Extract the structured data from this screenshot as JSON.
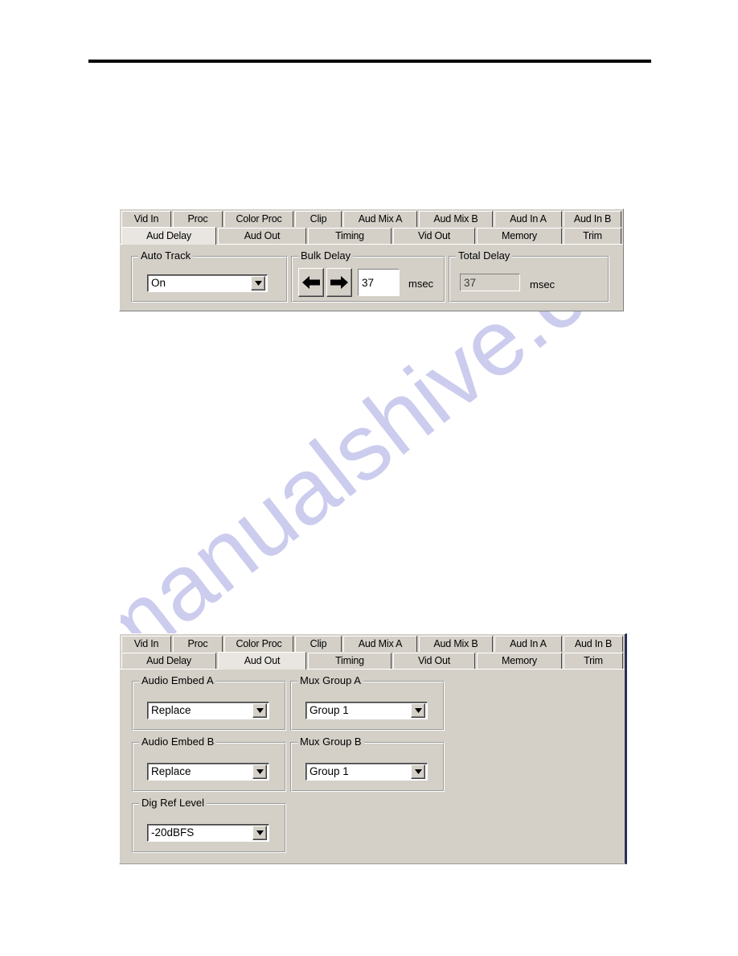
{
  "page": {
    "rule_visible": true,
    "watermark_text": "manualshive.com"
  },
  "colors": {
    "dialog_face": "#d4d0c8",
    "tab_selected": "#e9e6e1",
    "field_background": "#ffffff",
    "field_disabled": "#d4d0c8",
    "panel_edge_accent": "#2b2f55",
    "watermark": "#ccccee"
  },
  "tabs": {
    "row1": [
      {
        "label": "Vid In"
      },
      {
        "label": "Proc"
      },
      {
        "label": "Color Proc"
      },
      {
        "label": "Clip"
      },
      {
        "label": "Aud Mix A"
      },
      {
        "label": "Aud Mix B"
      },
      {
        "label": "Aud In A"
      },
      {
        "label": "Aud In B"
      }
    ],
    "row2": [
      {
        "label": "Aud Delay"
      },
      {
        "label": "Aud Out"
      },
      {
        "label": "Timing"
      },
      {
        "label": "Vid Out"
      },
      {
        "label": "Memory"
      },
      {
        "label": "Trim"
      }
    ]
  },
  "panel1": {
    "selected_tab": "Aud Delay",
    "auto_track": {
      "title": "Auto Track",
      "value": "On"
    },
    "bulk_delay": {
      "title": "Bulk Delay",
      "decrement_icon": "arrow-left-icon",
      "increment_icon": "arrow-right-icon",
      "value": "37",
      "units": "msec"
    },
    "total_delay": {
      "title": "Total Delay",
      "value": "37",
      "units": "msec"
    }
  },
  "panel2": {
    "selected_tab": "Aud Out",
    "audio_embed_a": {
      "title": "Audio Embed A",
      "value": "Replace"
    },
    "mux_group_a": {
      "title": "Mux Group A",
      "value": "Group 1"
    },
    "audio_embed_b": {
      "title": "Audio Embed B",
      "value": "Replace"
    },
    "mux_group_b": {
      "title": "Mux Group B",
      "value": "Group 1"
    },
    "dig_ref_level": {
      "title": "Dig Ref Level",
      "value": "-20dBFS"
    }
  }
}
